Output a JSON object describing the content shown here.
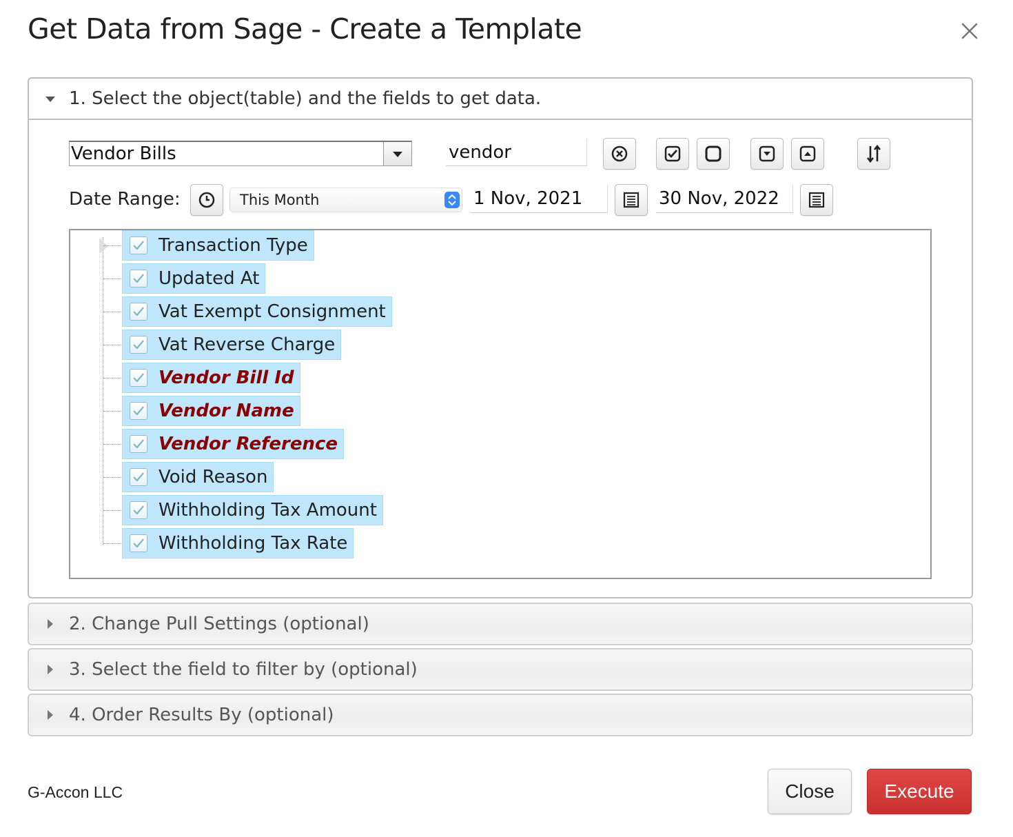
{
  "dialog": {
    "title": "Get Data from Sage - Create a Template",
    "close_icon": "close-icon"
  },
  "section1": {
    "label": "1. Select the object(table) and the fields to get data.",
    "object_select": {
      "value": "Vendor Bills"
    },
    "search": {
      "value": "vendor",
      "placeholder": ""
    },
    "toolbar_icons": [
      "clear-search-icon",
      "check-all-icon",
      "uncheck-all-icon",
      "expand-all-icon",
      "collapse-all-icon",
      "sort-icon"
    ],
    "date_range": {
      "label": "Date Range:",
      "clock_icon": "clock-icon",
      "preset": "This Month",
      "from": "1 Nov, 2021",
      "to": "30 Nov, 2022",
      "calendar_icon": "calendar-icon"
    },
    "fields": [
      {
        "label": "Transaction Type",
        "checked": true,
        "key": false
      },
      {
        "label": "Updated At",
        "checked": true,
        "key": false
      },
      {
        "label": "Vat Exempt Consignment",
        "checked": true,
        "key": false
      },
      {
        "label": "Vat Reverse Charge",
        "checked": true,
        "key": false
      },
      {
        "label": "Vendor Bill Id",
        "checked": true,
        "key": true
      },
      {
        "label": "Vendor Name",
        "checked": true,
        "key": true
      },
      {
        "label": "Vendor Reference",
        "checked": true,
        "key": true
      },
      {
        "label": "Void Reason",
        "checked": true,
        "key": false
      },
      {
        "label": "Withholding Tax Amount",
        "checked": true,
        "key": false
      },
      {
        "label": "Withholding Tax Rate",
        "checked": true,
        "key": false
      }
    ]
  },
  "section2": {
    "label": "2. Change Pull Settings (optional)"
  },
  "section3": {
    "label": "3. Select the field to filter by (optional)"
  },
  "section4": {
    "label": "4. Order Results By (optional)"
  },
  "footer": {
    "company": "G-Accon LLC",
    "close_label": "Close",
    "execute_label": "Execute",
    "execute_color": "#d33b3b"
  }
}
